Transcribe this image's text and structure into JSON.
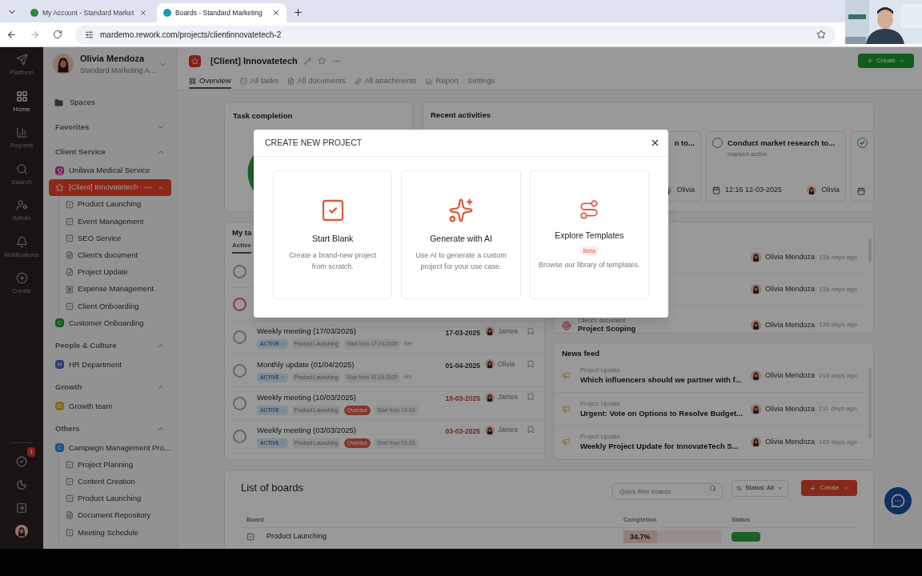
{
  "browser": {
    "tabs": [
      {
        "title": "My Account - Standard Market",
        "color": "#1e8e3e",
        "selected": false
      },
      {
        "title": "Boards - Standard Marketing",
        "color": "#1a9bb5",
        "selected": true
      }
    ],
    "url": "mardemo.rework.com/projects/clientinnovatetech-2"
  },
  "rail": {
    "items": [
      {
        "label": "Platform",
        "kind": "platform",
        "selected": false
      },
      {
        "label": "Home",
        "kind": "home",
        "selected": true
      },
      {
        "label": "Reports",
        "kind": "reports",
        "selected": false
      },
      {
        "label": "Search",
        "kind": "search",
        "selected": false
      },
      {
        "label": "Admin",
        "kind": "admin",
        "selected": false
      },
      {
        "label": "Notifications",
        "kind": "bell",
        "selected": false
      },
      {
        "label": "Create",
        "kind": "create",
        "selected": false
      }
    ],
    "bottom": [
      {
        "kind": "tasks",
        "badge": "1"
      },
      {
        "kind": "moon"
      },
      {
        "kind": "send"
      },
      {
        "kind": "avatar"
      }
    ]
  },
  "sidebar": {
    "user": {
      "name": "Olivia Mendoza",
      "org": "Standard Marketing A..."
    },
    "spaces": "Spaces",
    "sections": [
      {
        "title": "Favorites",
        "expanded": false
      },
      {
        "title": "Client Service",
        "expanded": true,
        "items": [
          {
            "label": "Unilava Medical Service",
            "kind": "trophy",
            "color": "#73205c",
            "selected": false
          },
          {
            "label": "[Client] Innovatetech",
            "kind": "star",
            "color": "#8b291a",
            "selected": true,
            "expanded": true,
            "children": [
              {
                "label": "Product Launching",
                "kind": "board"
              },
              {
                "label": "Event Management",
                "kind": "board"
              },
              {
                "label": "SEO Service",
                "kind": "board"
              },
              {
                "label": "Client's document",
                "kind": "document"
              },
              {
                "label": "Project Update",
                "kind": "update"
              },
              {
                "label": "Expense Management",
                "kind": "expense"
              },
              {
                "label": "Client Onboarding",
                "kind": "board"
              }
            ]
          },
          {
            "label": "Customer Onboarding",
            "kind": "letter",
            "letter": "C",
            "color": "#135c1c",
            "selected": false
          }
        ]
      },
      {
        "title": "People & Culture",
        "expanded": true,
        "items": [
          {
            "label": "HR Department",
            "kind": "letter",
            "letter": "H",
            "color": "#363978",
            "selected": false
          }
        ]
      },
      {
        "title": "Growth",
        "expanded": true,
        "items": [
          {
            "label": "Growth team",
            "kind": "letter",
            "letter": "G",
            "color": "#866a13",
            "selected": false
          }
        ]
      },
      {
        "title": "Others",
        "expanded": true,
        "items": [
          {
            "label": "Campaign Management Pro...",
            "kind": "letter",
            "letter": "C",
            "color": "#195080",
            "selected": false,
            "expanded": true,
            "children": [
              {
                "label": "Project Planning",
                "kind": "board"
              },
              {
                "label": "Content Creation",
                "kind": "board"
              },
              {
                "label": "Product Launching",
                "kind": "board"
              },
              {
                "label": "Document Repository",
                "kind": "document"
              },
              {
                "label": "Meeting Schedule",
                "kind": "board"
              }
            ]
          }
        ]
      }
    ]
  },
  "project": {
    "title": "[Client] Innovatetech",
    "create": "Create",
    "tabs": [
      {
        "label": "Overview",
        "kind": "grid",
        "selected": true
      },
      {
        "label": "All tasks",
        "kind": "check",
        "selected": false
      },
      {
        "label": "All documents",
        "kind": "doc",
        "selected": false
      },
      {
        "label": "All attachments",
        "kind": "clip",
        "selected": false
      },
      {
        "label": "Report",
        "kind": "chart",
        "selected": false
      },
      {
        "label": "Settings",
        "kind": "plain",
        "selected": false
      }
    ]
  },
  "task_completion": {
    "title": "Task completion"
  },
  "recent_activities": {
    "title": "Recent activities",
    "cards": [
      {
        "title": "n to...",
        "user": "Olivia"
      },
      {
        "title": "Conduct market research to...",
        "note": "marked active",
        "time": "12:16 12-03-2025",
        "user": "Olivia",
        "done": false
      },
      {
        "done": true
      }
    ]
  },
  "my_tasks": {
    "title": "My ta",
    "tab": "Active",
    "rows": [
      {
        "color": "#666666"
      },
      {
        "color": "#824036"
      },
      {
        "color": "#666666",
        "title": "Weekly meeting (17/03/2025)",
        "status": "ACTIVE",
        "project": "Product Launching",
        "start": "Start from 17-03-2025",
        "extra": "We",
        "date": "17-03-2025",
        "user": "James",
        "overdue": false
      },
      {
        "color": "#666666",
        "title": "Monthly update (01/04/2025)",
        "status": "ACTIVE",
        "project": "Product Launching",
        "start": "Start from 01-04-2025",
        "extra": "Mo",
        "date": "01-04-2025",
        "user": "Olivia",
        "overdue": false
      },
      {
        "color": "#666666",
        "title": "Weekly meeting (10/03/2025)",
        "status": "ACTIVE",
        "project": "Product Launching",
        "badge": "Overdue",
        "start": "Start from 10-03-",
        "date": "10-03-2025",
        "user": "James",
        "overdue": true
      },
      {
        "color": "#666666",
        "title": "Weekly meeting (03/03/2025)",
        "status": "ACTIVE",
        "project": "Product Launching",
        "badge": "Overdue",
        "start": "Start from 03-03-",
        "date": "03-03-2025",
        "user": "James",
        "overdue": true
      }
    ]
  },
  "documents": {
    "rows": [
      {
        "user": "Olivia Mendoza",
        "ago": "138 days ago"
      },
      {
        "user": "Olivia Mendoza",
        "ago": "138 days ago"
      },
      {
        "category": "Client's document",
        "title": "Project Scoping",
        "user": "Olivia Mendoza",
        "ago": "135 days ago"
      }
    ]
  },
  "news_feed": {
    "title": "News feed",
    "items": [
      {
        "category": "Project Update",
        "title": "Which influencers should we partner with f...",
        "user": "Olivia Mendoza",
        "ago": "210 days ago"
      },
      {
        "category": "Project Update",
        "title": "Urgent: Vote on Options to Resolve Budget...",
        "user": "Olivia Mendoza",
        "ago": "211 days ago"
      },
      {
        "category": "Project Update",
        "title": "Weekly Project Update for InnovateTech S...",
        "user": "Olivia Mendoza",
        "ago": "165 days ago"
      }
    ]
  },
  "boards": {
    "title": "List of boards",
    "search": {
      "placeholder": "Quick filter boards"
    },
    "filter": "Status: All",
    "create": "Create",
    "columns": [
      "Board",
      "Completion",
      "Status"
    ],
    "rows": [
      {
        "name": "Product Launching",
        "completion": "34.7%",
        "level": 0.347,
        "color": "#1c6028"
      }
    ]
  },
  "modal": {
    "title": "CREATE NEW PROJECT",
    "options": [
      {
        "kind": "blank",
        "title": "Start Blank",
        "description": "Create a brand-new project from scratch."
      },
      {
        "kind": "ai",
        "title": "Generate with AI",
        "description": "Use AI to generate a custom project for your use case."
      },
      {
        "kind": "templates",
        "title": "Explore Templates",
        "badge": "Beta",
        "description": "Browse our library of templates."
      }
    ]
  }
}
